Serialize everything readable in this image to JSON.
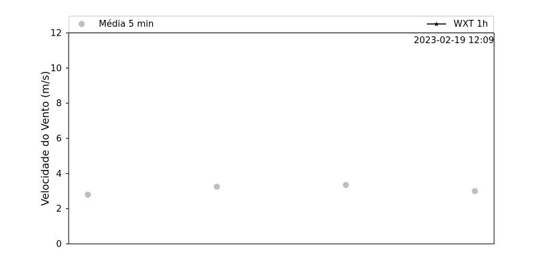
{
  "chart_data": {
    "type": "scatter",
    "title": "",
    "xlabel": "",
    "ylabel": "Velocidade do Vento (m/s)",
    "ylim": [
      0,
      12
    ],
    "yticks": [
      0,
      2,
      4,
      6,
      8,
      10,
      12
    ],
    "grid": false,
    "legend_placement": "top",
    "timestamp": "2023-02-19 12:09",
    "series": [
      {
        "name": "Média 5 min",
        "marker": "circle",
        "color": "#bfbfbf",
        "values": [
          2.8,
          3.25,
          3.35,
          3.0
        ]
      },
      {
        "name": "WXT 1h",
        "marker": "star-line",
        "color": "#000000",
        "values": []
      }
    ]
  }
}
